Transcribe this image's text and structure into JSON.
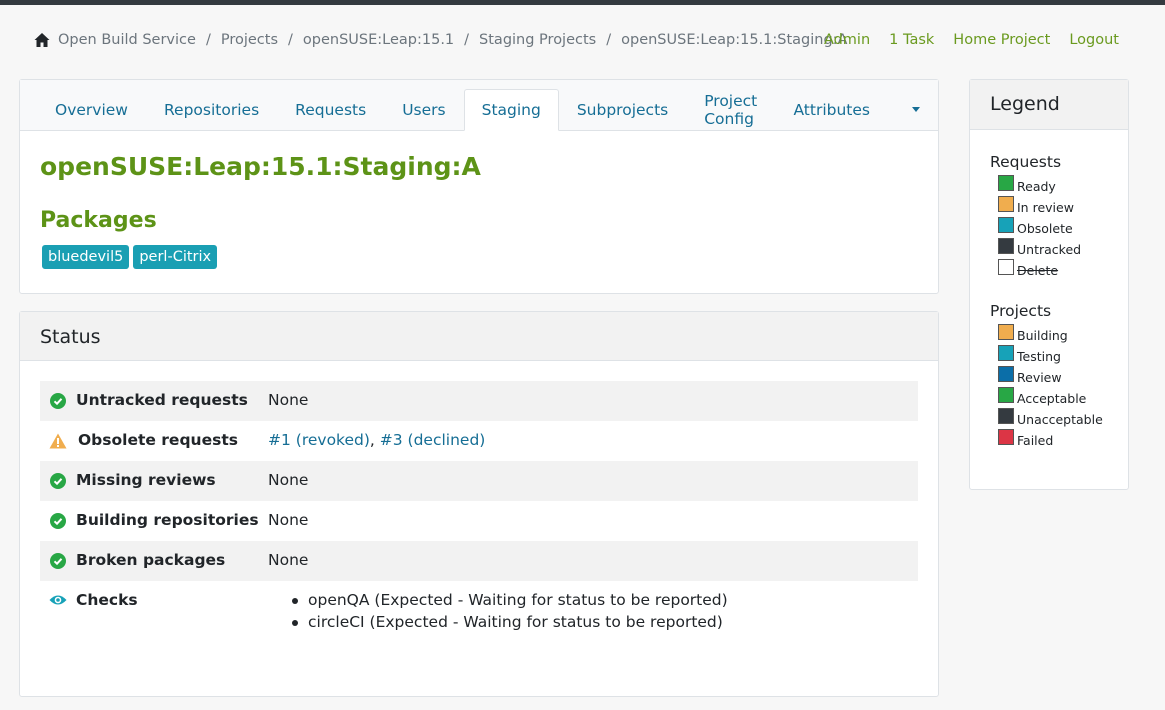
{
  "breadcrumb": [
    "Open Build Service",
    "Projects",
    "openSUSE:Leap:15.1",
    "Staging Projects",
    "openSUSE:Leap:15.1:Staging:A"
  ],
  "topnav": {
    "admin": "Admin",
    "tasks": "1 Task",
    "home_project": "Home Project",
    "logout": "Logout"
  },
  "tabs": [
    "Overview",
    "Repositories",
    "Requests",
    "Users",
    "Staging",
    "Subprojects",
    "Project Config",
    "Attributes"
  ],
  "active_tab": "Staging",
  "project_title": "openSUSE:Leap:15.1:Staging:A",
  "packages_heading": "Packages",
  "packages": [
    "bluedevil5",
    "perl-Citrix"
  ],
  "status": {
    "heading": "Status",
    "untracked": {
      "label": "Untracked requests",
      "value": "None"
    },
    "obsolete": {
      "label": "Obsolete requests",
      "link1": "#1 (revoked)",
      "sep": ", ",
      "link2": "#3 (declined)"
    },
    "missing": {
      "label": "Missing reviews",
      "value": "None"
    },
    "building": {
      "label": "Building repositories",
      "value": "None"
    },
    "broken": {
      "label": "Broken packages",
      "value": "None"
    },
    "checks": {
      "label": "Checks",
      "items": [
        "openQA (Expected - Waiting for status to be reported)",
        "circleCI (Expected - Waiting for status to be reported)"
      ]
    }
  },
  "legend": {
    "heading": "Legend",
    "requests_heading": "Requests",
    "requests": [
      {
        "label": "Ready",
        "color": "#28a745"
      },
      {
        "label": "In review",
        "color": "#f0ad4e"
      },
      {
        "label": "Obsolete",
        "color": "#17a2b8"
      },
      {
        "label": "Untracked",
        "color": "#343a40"
      },
      {
        "label": "Delete",
        "color": "#ffffff"
      }
    ],
    "projects_heading": "Projects",
    "projects": [
      {
        "label": "Building",
        "color": "#f0ad4e"
      },
      {
        "label": "Testing",
        "color": "#17a2b8"
      },
      {
        "label": "Review",
        "color": "#0b6ea8"
      },
      {
        "label": "Acceptable",
        "color": "#28a745"
      },
      {
        "label": "Unacceptable",
        "color": "#343a40"
      },
      {
        "label": "Failed",
        "color": "#dc3545"
      }
    ]
  }
}
